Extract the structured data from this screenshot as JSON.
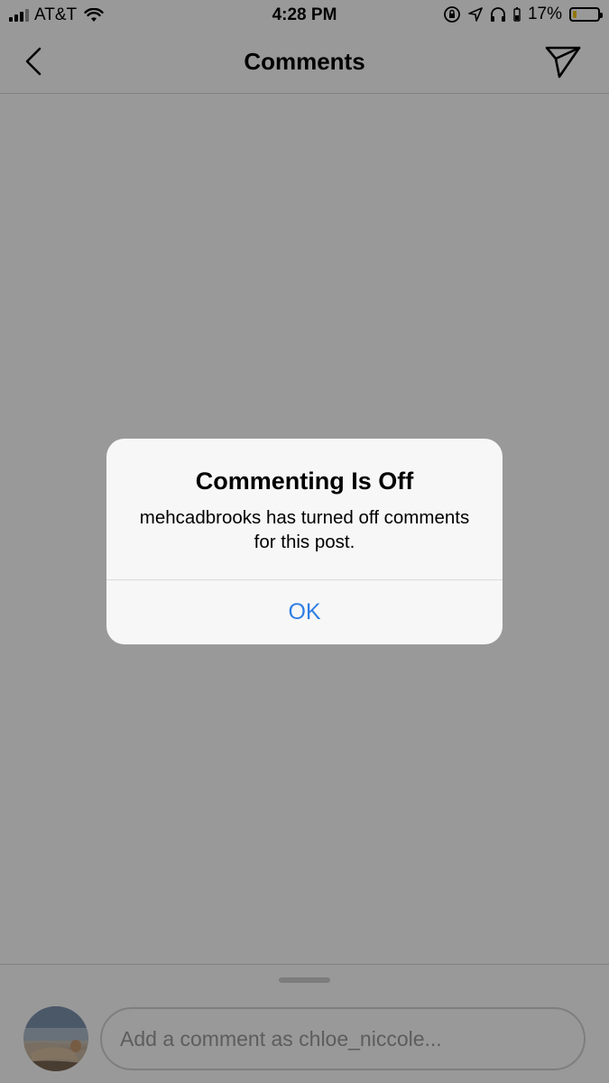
{
  "status_bar": {
    "carrier": "AT&T",
    "time": "4:28 PM",
    "battery_percent": "17%",
    "battery_level": 0.17,
    "icons": [
      "signal-icon",
      "wifi-icon",
      "orientation-lock-icon",
      "location-icon",
      "headphones-icon",
      "battery-icon"
    ]
  },
  "nav": {
    "title": "Comments",
    "back_icon": "chevron-left-icon",
    "send_icon": "direct-send-icon"
  },
  "composer": {
    "placeholder": "Add a comment as chloe_niccole...",
    "value": ""
  },
  "alert": {
    "title": "Commenting Is Off",
    "message": "mehcadbrooks has turned off comments for this post.",
    "ok_label": "OK"
  },
  "colors": {
    "alert_button": "#2f7fe4",
    "battery_fill": "#f5c400",
    "overlay": "rgba(0,0,0,0.40)"
  }
}
